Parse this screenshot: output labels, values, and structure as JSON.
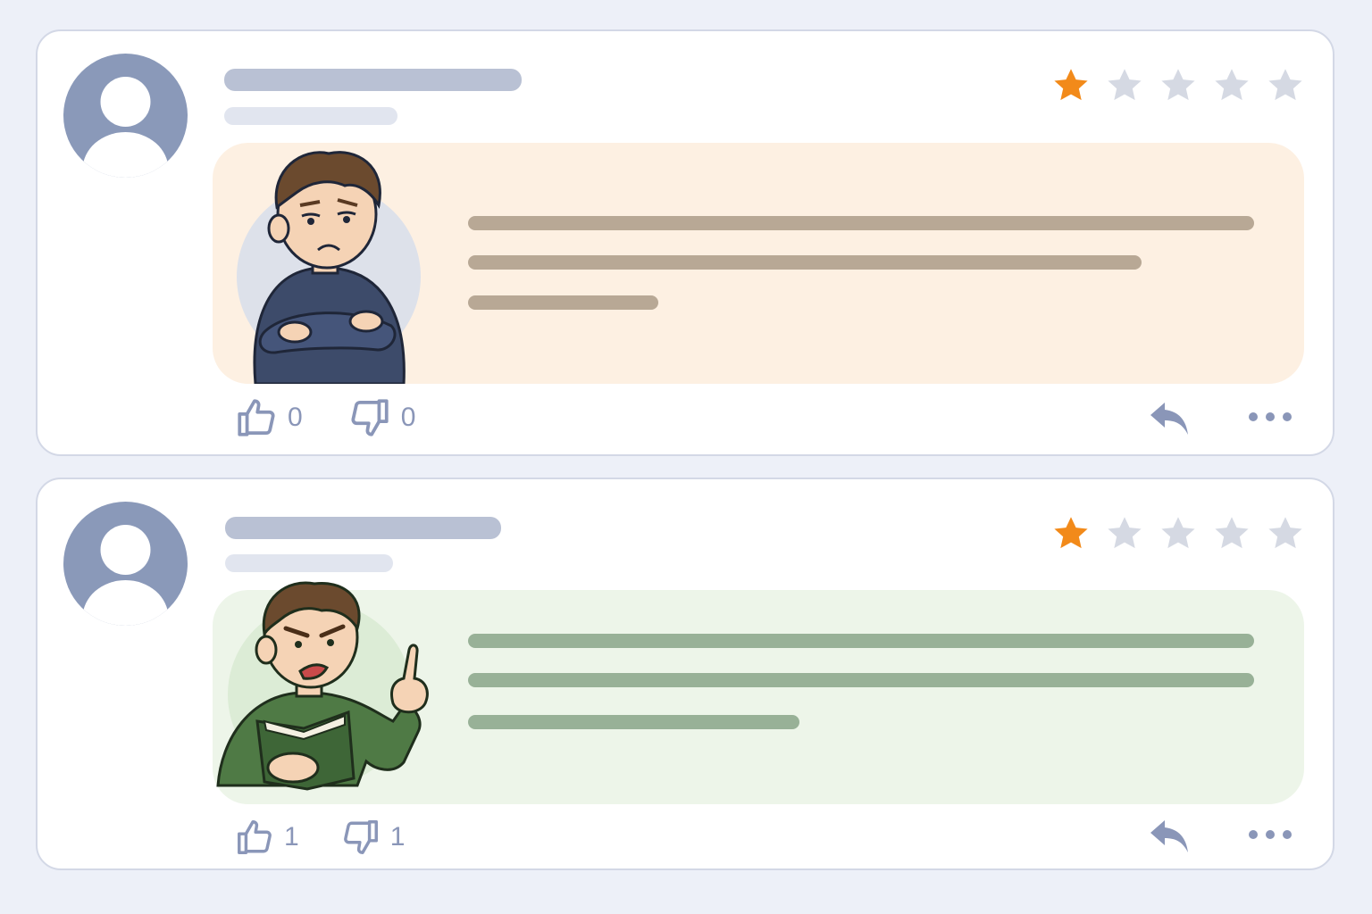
{
  "reviews": [
    {
      "rating": 1,
      "max_rating": 5,
      "likes": "0",
      "dislikes": "0",
      "bubble_color": "#fdf0e2",
      "text_line_color": "#b8a895",
      "illustration": "sad-man-arms-crossed"
    },
    {
      "rating": 1,
      "max_rating": 5,
      "likes": "1",
      "dislikes": "1",
      "bubble_color": "#edf5e9",
      "text_line_color": "#98b197",
      "illustration": "angry-man-pointing-with-book"
    }
  ],
  "colors": {
    "star_active": "#f28a1a",
    "star_inactive": "#d5d9e3",
    "icon": "#8a96b8",
    "avatar": "#8a99b9"
  },
  "icons": [
    "user-avatar-icon",
    "star-icon",
    "thumbs-up-icon",
    "thumbs-down-icon",
    "reply-icon",
    "more-icon"
  ]
}
